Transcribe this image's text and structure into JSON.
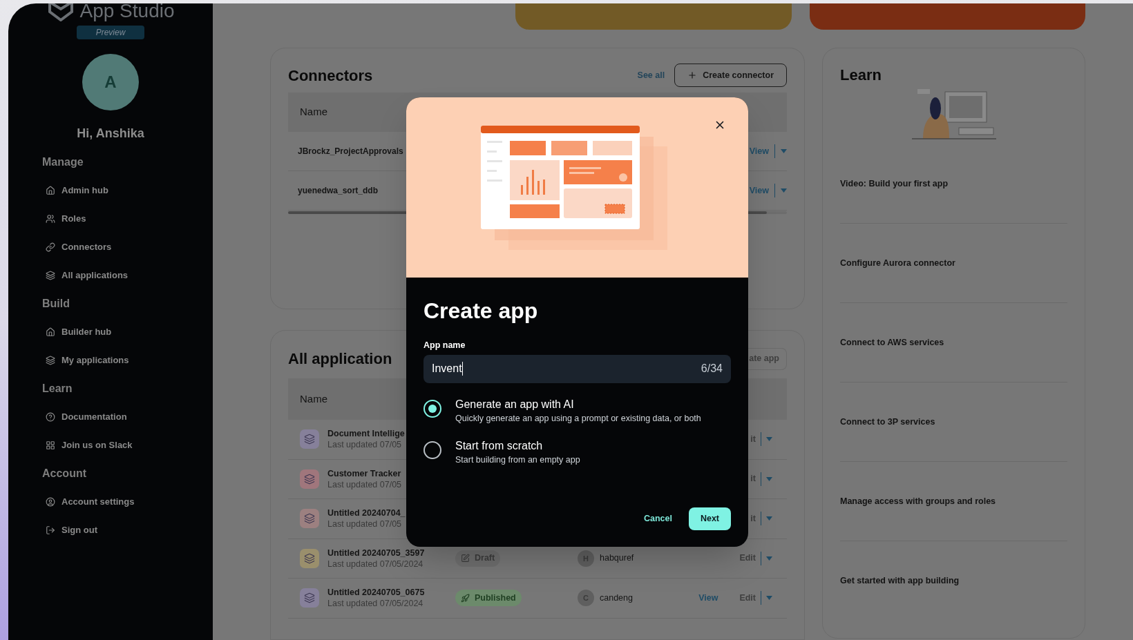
{
  "sidebar": {
    "logo": "App Studio",
    "badge": "Preview",
    "avatar_initial": "A",
    "greeting": "Hi, Anshika",
    "sections": [
      {
        "title": "Manage",
        "items": [
          "Admin hub",
          "Roles",
          "Connectors",
          "All applications"
        ]
      },
      {
        "title": "Build",
        "items": [
          "Builder hub",
          "My applications"
        ]
      },
      {
        "title": "Learn",
        "items": [
          "Documentation",
          "Join us on Slack"
        ]
      },
      {
        "title": "Account",
        "items": [
          "Account settings",
          "Sign out"
        ]
      }
    ]
  },
  "connectors": {
    "title": "Connectors",
    "see_all": "See all",
    "create_button": "Create connector",
    "columns": [
      "Name"
    ],
    "rows": [
      {
        "name": "JBrockz_ProjectApprovals",
        "action": "View"
      },
      {
        "name": "yuenedwa_sort_ddb",
        "action": "View"
      }
    ]
  },
  "all_applications": {
    "title": "All application",
    "create_button": "ate app",
    "columns": [
      "Name"
    ],
    "rows": [
      {
        "name": "Document Intellige",
        "updated": "Last updated 07/05",
        "color": "#86809a",
        "edit": "it"
      },
      {
        "name": "Customer Tracker",
        "updated": "Last updated 07/05",
        "color": "#a0767c",
        "edit": "it"
      },
      {
        "name": "Untitled 20240704_",
        "updated": "Last updated 07/05",
        "color": "#9c8080",
        "edit": "it"
      },
      {
        "name": "Untitled 20240705_3597",
        "updated": "Last updated 07/05/2024",
        "color": "#9a8f6c",
        "status": {
          "label": "Draft",
          "kind": "draft"
        },
        "owner": {
          "initial": "H",
          "name": "habquref"
        },
        "edit": "Edit"
      },
      {
        "name": "Untitled 20240705_0675",
        "updated": "Last updated 07/05/2024",
        "color": "#86809a",
        "status": {
          "label": "Published",
          "kind": "published"
        },
        "owner": {
          "initial": "C",
          "name": "candeng"
        },
        "view": "View",
        "edit": "Edit"
      }
    ]
  },
  "learn": {
    "title": "Learn",
    "items": [
      "Video: Build your first app",
      "Configure Aurora connector",
      "Connect to AWS services",
      "Connect to 3P services",
      "Manage access with groups and roles",
      "Get started with app building"
    ]
  },
  "dialog": {
    "title": "Create app",
    "field_label": "App name",
    "value": "Invent",
    "counter": "6/34",
    "options": [
      {
        "title": "Generate an app with AI",
        "description": "Quickly generate an app using a prompt or existing data, or both",
        "selected": true
      },
      {
        "title": "Start from scratch",
        "description": "Start building from an empty app",
        "selected": false
      }
    ],
    "cancel": "Cancel",
    "next": "Next"
  }
}
